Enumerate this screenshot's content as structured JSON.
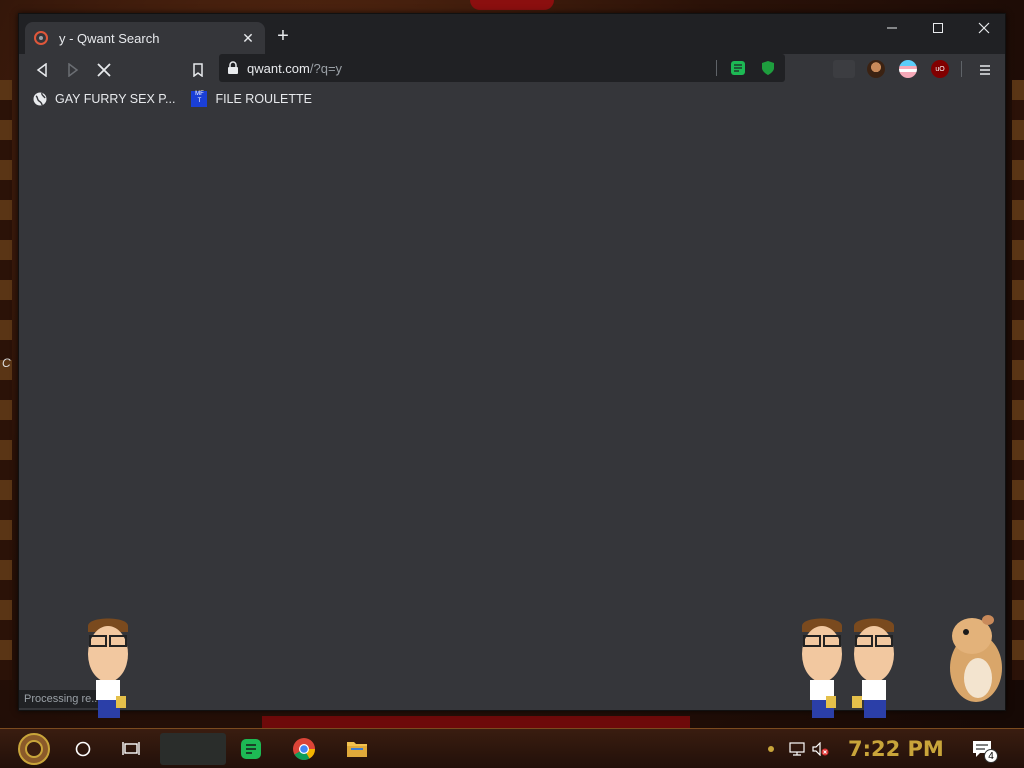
{
  "tab": {
    "title": "y - Qwant Search",
    "close_icon": "close-icon",
    "favicon": "qwant-favicon"
  },
  "new_tab_label": "+",
  "window_controls": {
    "minimize": "—",
    "maximize": "☐",
    "close": "✕"
  },
  "nav": {
    "back": "back-icon",
    "forward": "forward-icon",
    "stop": "stop-loading-icon",
    "bookmark": "bookmark-icon"
  },
  "omnibox": {
    "host": "qwant.com",
    "path": "/?q=y"
  },
  "bookmarks": [
    {
      "label": "GAY FURRY SEX P...",
      "icon": "globe-icon"
    },
    {
      "label": "FILE ROULETTE",
      "icon": "file-roulette-icon"
    }
  ],
  "status_text": "Processing re...",
  "desktop_fragment": "C",
  "clock": "7:22 PM",
  "notification_count": "4",
  "colors": {
    "window_bg": "#35363a",
    "titlebar_bg": "#202124",
    "clock": "#c9a53a",
    "accent_green": "#1db954"
  }
}
